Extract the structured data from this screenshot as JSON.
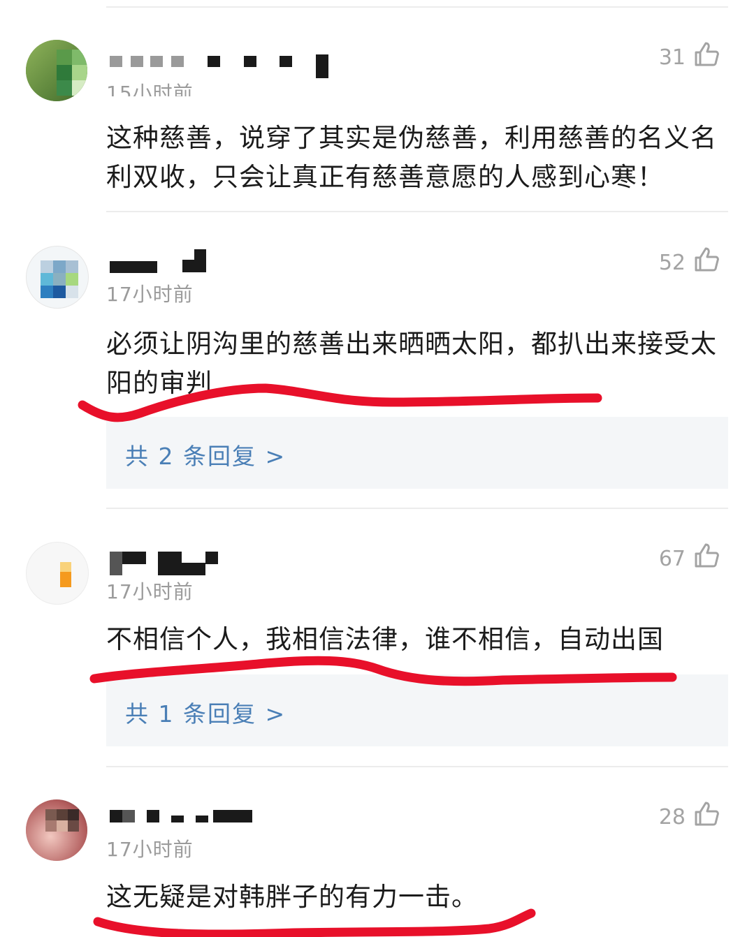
{
  "comments": [
    {
      "time": "15小时前",
      "likes": "31",
      "text": "这种慈善，说穿了其实是伪慈善，利用慈善的名义名利双收，只会让真正有慈善意愿的人感到心寒！",
      "reply": null
    },
    {
      "time": "17小时前",
      "likes": "52",
      "text": "必须让阴沟里的慈善出来晒晒太阳，都扒出来接受太阳的审判",
      "reply": "共 2 条回复 >"
    },
    {
      "time": "17小时前",
      "likes": "67",
      "text": "不相信个人，我相信法律，谁不相信，自动出国",
      "reply": "共 1 条回复 >"
    },
    {
      "time": "17小时前",
      "likes": "28",
      "text": "这无疑是对韩胖子的有力一击。",
      "reply": null
    }
  ],
  "icons": {
    "like": "thumbs-up-icon"
  },
  "colors": {
    "annotation": "#e8102a",
    "reply_link": "#4a7fb6",
    "meta": "#9b9b9b"
  }
}
